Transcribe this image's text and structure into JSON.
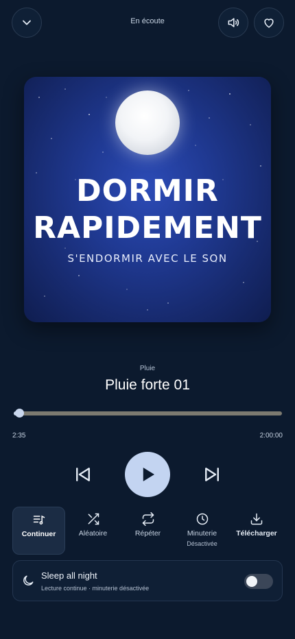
{
  "header": {
    "title": "En écoute",
    "back_icon": "chevron-down-icon",
    "volume_icon": "volume-icon",
    "favorite_icon": "heart-icon"
  },
  "cover": {
    "line1": "DORMIR",
    "line2": "RAPIDEMENT",
    "subtitle": "S'ENDORMIR AVEC LE SON"
  },
  "track": {
    "category": "Pluie",
    "title": "Pluie forte 01"
  },
  "progress": {
    "elapsed": "2:35",
    "total": "2:00:00",
    "fraction": 0.0215
  },
  "controls": {
    "prev_icon": "skip-previous-icon",
    "play_icon": "play-icon",
    "next_icon": "skip-next-icon"
  },
  "options": {
    "continue_label": "Continuer",
    "shuffle_label": "Aléatoire",
    "repeat_label": "Répéter",
    "timer_label": "Minuterie",
    "timer_status": "Désactivée",
    "download_label": "Télécharger"
  },
  "sleep": {
    "title": "Sleep all night",
    "subtitle": "Lecture continue · minuterie désactivée",
    "enabled": false
  },
  "colors": {
    "background": "#0c1a2e",
    "accent": "#c3d4f1"
  }
}
